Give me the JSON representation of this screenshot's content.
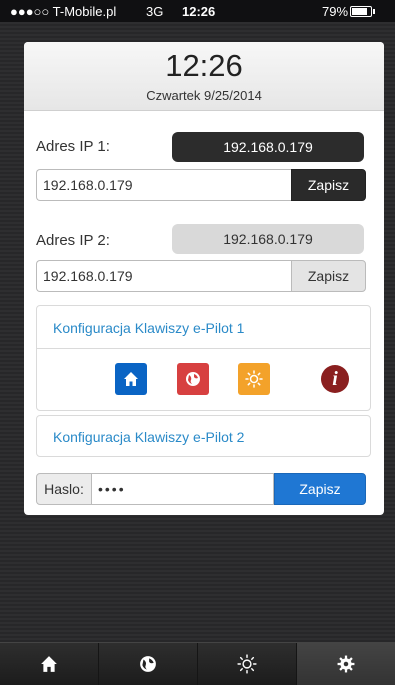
{
  "status_bar": {
    "carrier": "●●●○○ T-Mobile.pl",
    "network": "3G",
    "time": "12:26",
    "battery": "79%"
  },
  "header": {
    "time": "12:26",
    "date": "Czwartek 9/25/2014"
  },
  "ip1": {
    "label": "Adres IP 1:",
    "current": "192.168.0.179",
    "input_value": "192.168.0.179",
    "save_label": "Zapisz"
  },
  "ip2": {
    "label": "Adres IP 2:",
    "current": "192.168.0.179",
    "input_value": "192.168.0.179",
    "save_label": "Zapisz"
  },
  "pilot1": {
    "link": "Konfiguracja Klawiszy e-Pilot 1",
    "info_glyph": "i",
    "keys": [
      {
        "icon": "home-icon",
        "color": "#0a64c4"
      },
      {
        "icon": "globe-icon",
        "color": "#d74040"
      },
      {
        "icon": "sun-icon",
        "color": "#f3a22a"
      },
      {
        "icon": "info-icon",
        "color": "#8a1f1f"
      }
    ]
  },
  "pilot2": {
    "link": "Konfiguracja Klawiszy e-Pilot 2"
  },
  "password": {
    "label": "Haslo:",
    "value": "••••",
    "save_label": "Zapisz"
  },
  "tabbar": {
    "tabs": [
      "home-icon",
      "globe-icon",
      "sun-icon",
      "gear-icon"
    ],
    "active": "gear-icon"
  }
}
